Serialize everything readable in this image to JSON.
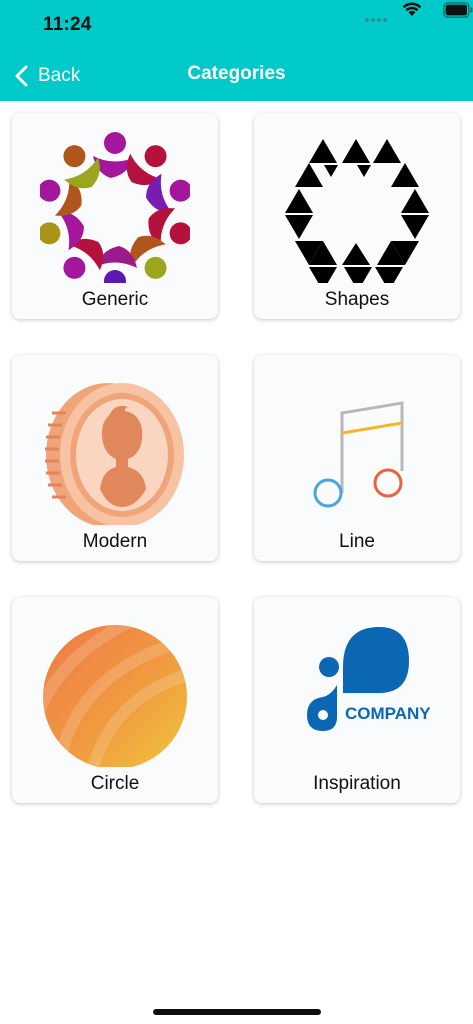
{
  "status_bar": {
    "time": "11:24"
  },
  "nav": {
    "back_label": "Back",
    "title": "Categories"
  },
  "categories": [
    {
      "label": "Generic",
      "icon": "people-circle-icon"
    },
    {
      "label": "Shapes",
      "icon": "triangle-hexagon-icon"
    },
    {
      "label": "Modern",
      "icon": "person-coin-icon"
    },
    {
      "label": "Line",
      "icon": "music-note-icon"
    },
    {
      "label": "Circle",
      "icon": "gradient-circle-icon"
    },
    {
      "label": "Inspiration",
      "icon": "company-logo-icon",
      "logo_text": "COMPANY"
    }
  ],
  "colors": {
    "header": "#00C9C9",
    "card_background": "#fafbfc",
    "logo_blue": "#0B66B3"
  }
}
